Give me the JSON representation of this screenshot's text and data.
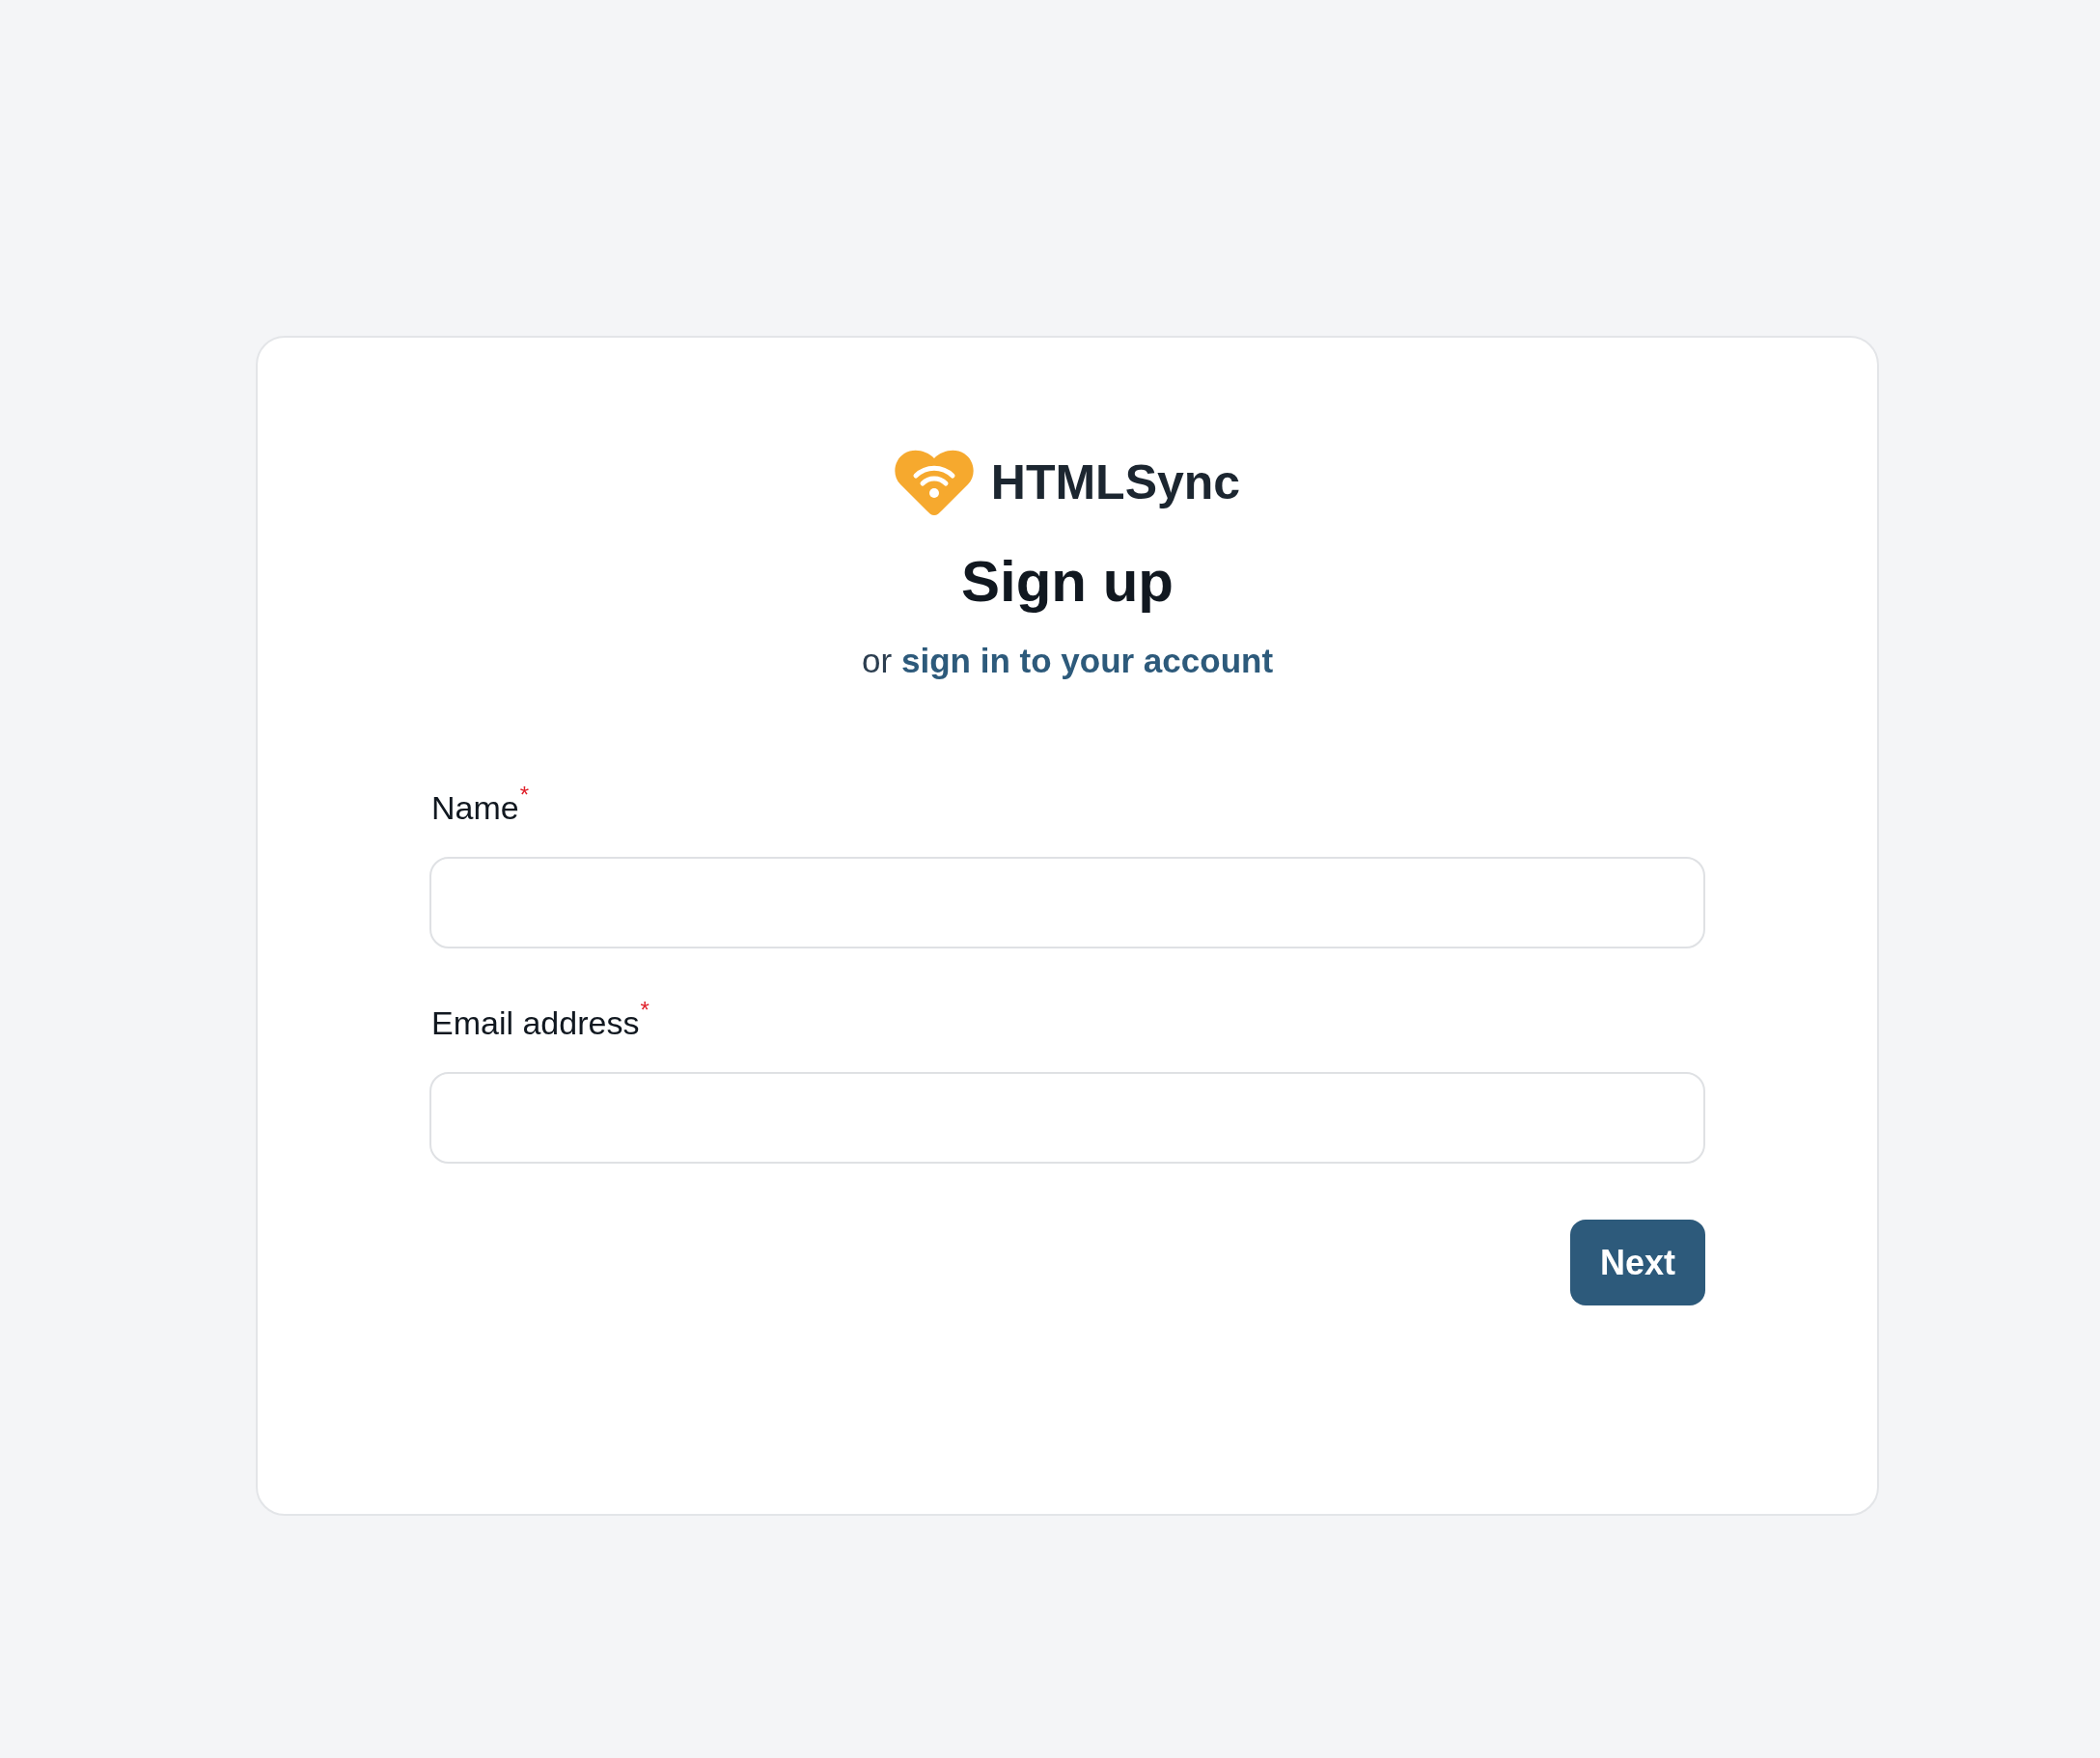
{
  "brand": {
    "name": "HTMLSync"
  },
  "heading": "Sign up",
  "subheading": {
    "prefix": "or",
    "link": "sign in to your account"
  },
  "fields": [
    {
      "label": "Name",
      "required_mark": "*"
    },
    {
      "label": "Email address",
      "required_mark": "*"
    }
  ],
  "submit_button": "Next"
}
